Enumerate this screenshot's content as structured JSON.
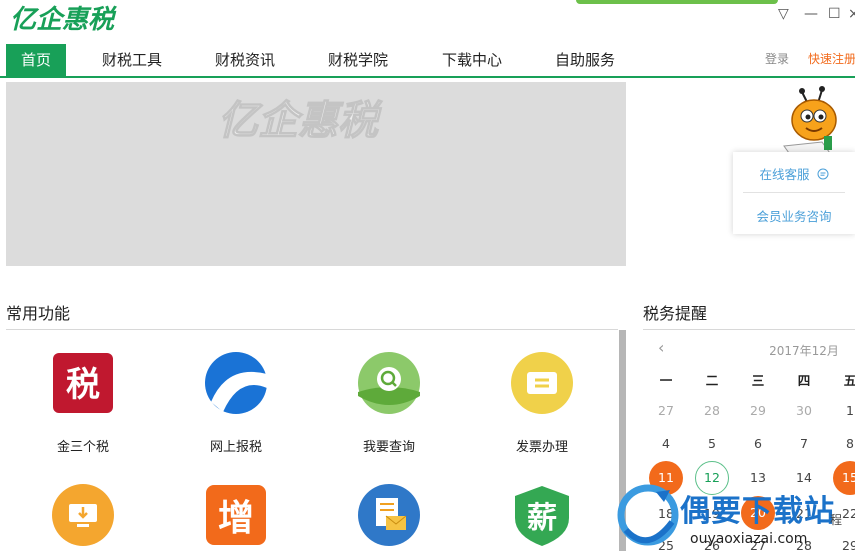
{
  "app": {
    "logo_text": "亿企惠税"
  },
  "window_controls": {
    "dropdown": "▽",
    "minimize": "—",
    "maximize": "☐",
    "close": "×"
  },
  "nav": {
    "items": [
      {
        "label": "首页",
        "active": true
      },
      {
        "label": "财税工具"
      },
      {
        "label": "财税资讯"
      },
      {
        "label": "财税学院"
      },
      {
        "label": "下载中心"
      },
      {
        "label": "自助服务"
      }
    ],
    "login": "登录",
    "register": "快速注册"
  },
  "banner": {
    "logo_text": "亿企惠税"
  },
  "service": {
    "online": "在线客服",
    "member": "会员业务咨询"
  },
  "common": {
    "title": "常用功能",
    "items": [
      {
        "label": "金三个税",
        "icon": "tax-icon",
        "glyph": "税"
      },
      {
        "label": "网上报税",
        "icon": "online-filing-icon"
      },
      {
        "label": "我要查询",
        "icon": "query-icon"
      },
      {
        "label": "发票办理",
        "icon": "invoice-icon"
      },
      {
        "label": "",
        "icon": "download-monitor-icon"
      },
      {
        "label": "",
        "icon": "vat-icon",
        "glyph": "增"
      },
      {
        "label": "",
        "icon": "mail-document-icon"
      },
      {
        "label": "",
        "icon": "salary-icon",
        "glyph": "薪"
      }
    ]
  },
  "calendar": {
    "title": "税务提醒",
    "month": "2017年12月",
    "prev": "‹",
    "weekdays": [
      "一",
      "二",
      "三",
      "四",
      "五"
    ],
    "rows": [
      [
        "27",
        "28",
        "29",
        "30",
        "1"
      ],
      [
        "4",
        "5",
        "6",
        "7",
        "8"
      ],
      [
        "11",
        "12",
        "13",
        "14",
        "15"
      ],
      [
        "18",
        "19",
        "20",
        "21",
        "22"
      ],
      [
        "25",
        "26",
        "27",
        "28",
        "29"
      ]
    ],
    "cut_label": "程"
  },
  "watermark": {
    "title": "偶要下载站",
    "url": "ouyaoxiazai.com"
  },
  "colors": {
    "brand_green": "#18a058",
    "accent_orange": "#f26a1b",
    "service_blue": "#4a9fd8",
    "watermark_blue": "#1b72c9"
  }
}
